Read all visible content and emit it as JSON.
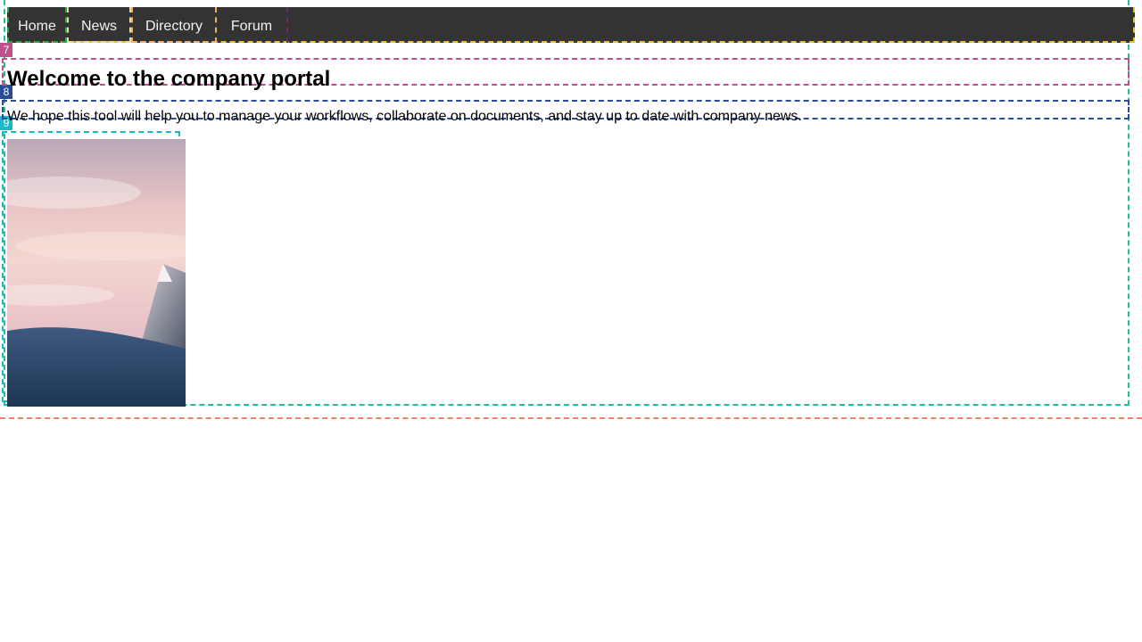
{
  "nav": {
    "items": [
      {
        "label": "Home"
      },
      {
        "label": "News"
      },
      {
        "label": "Directory"
      },
      {
        "label": "Forum"
      }
    ]
  },
  "badges": [
    "7",
    "8",
    "9"
  ],
  "main": {
    "title": "Welcome to the company portal",
    "intro": "We hope this tool will help you to manage your workflows, collaborate on documents, and stay up to date with company news."
  },
  "image": {
    "subject": "snowy-mountain-sunset-photo"
  },
  "colors": {
    "navbar_bg": "#333333",
    "nav_text": "#f2f2f2"
  }
}
